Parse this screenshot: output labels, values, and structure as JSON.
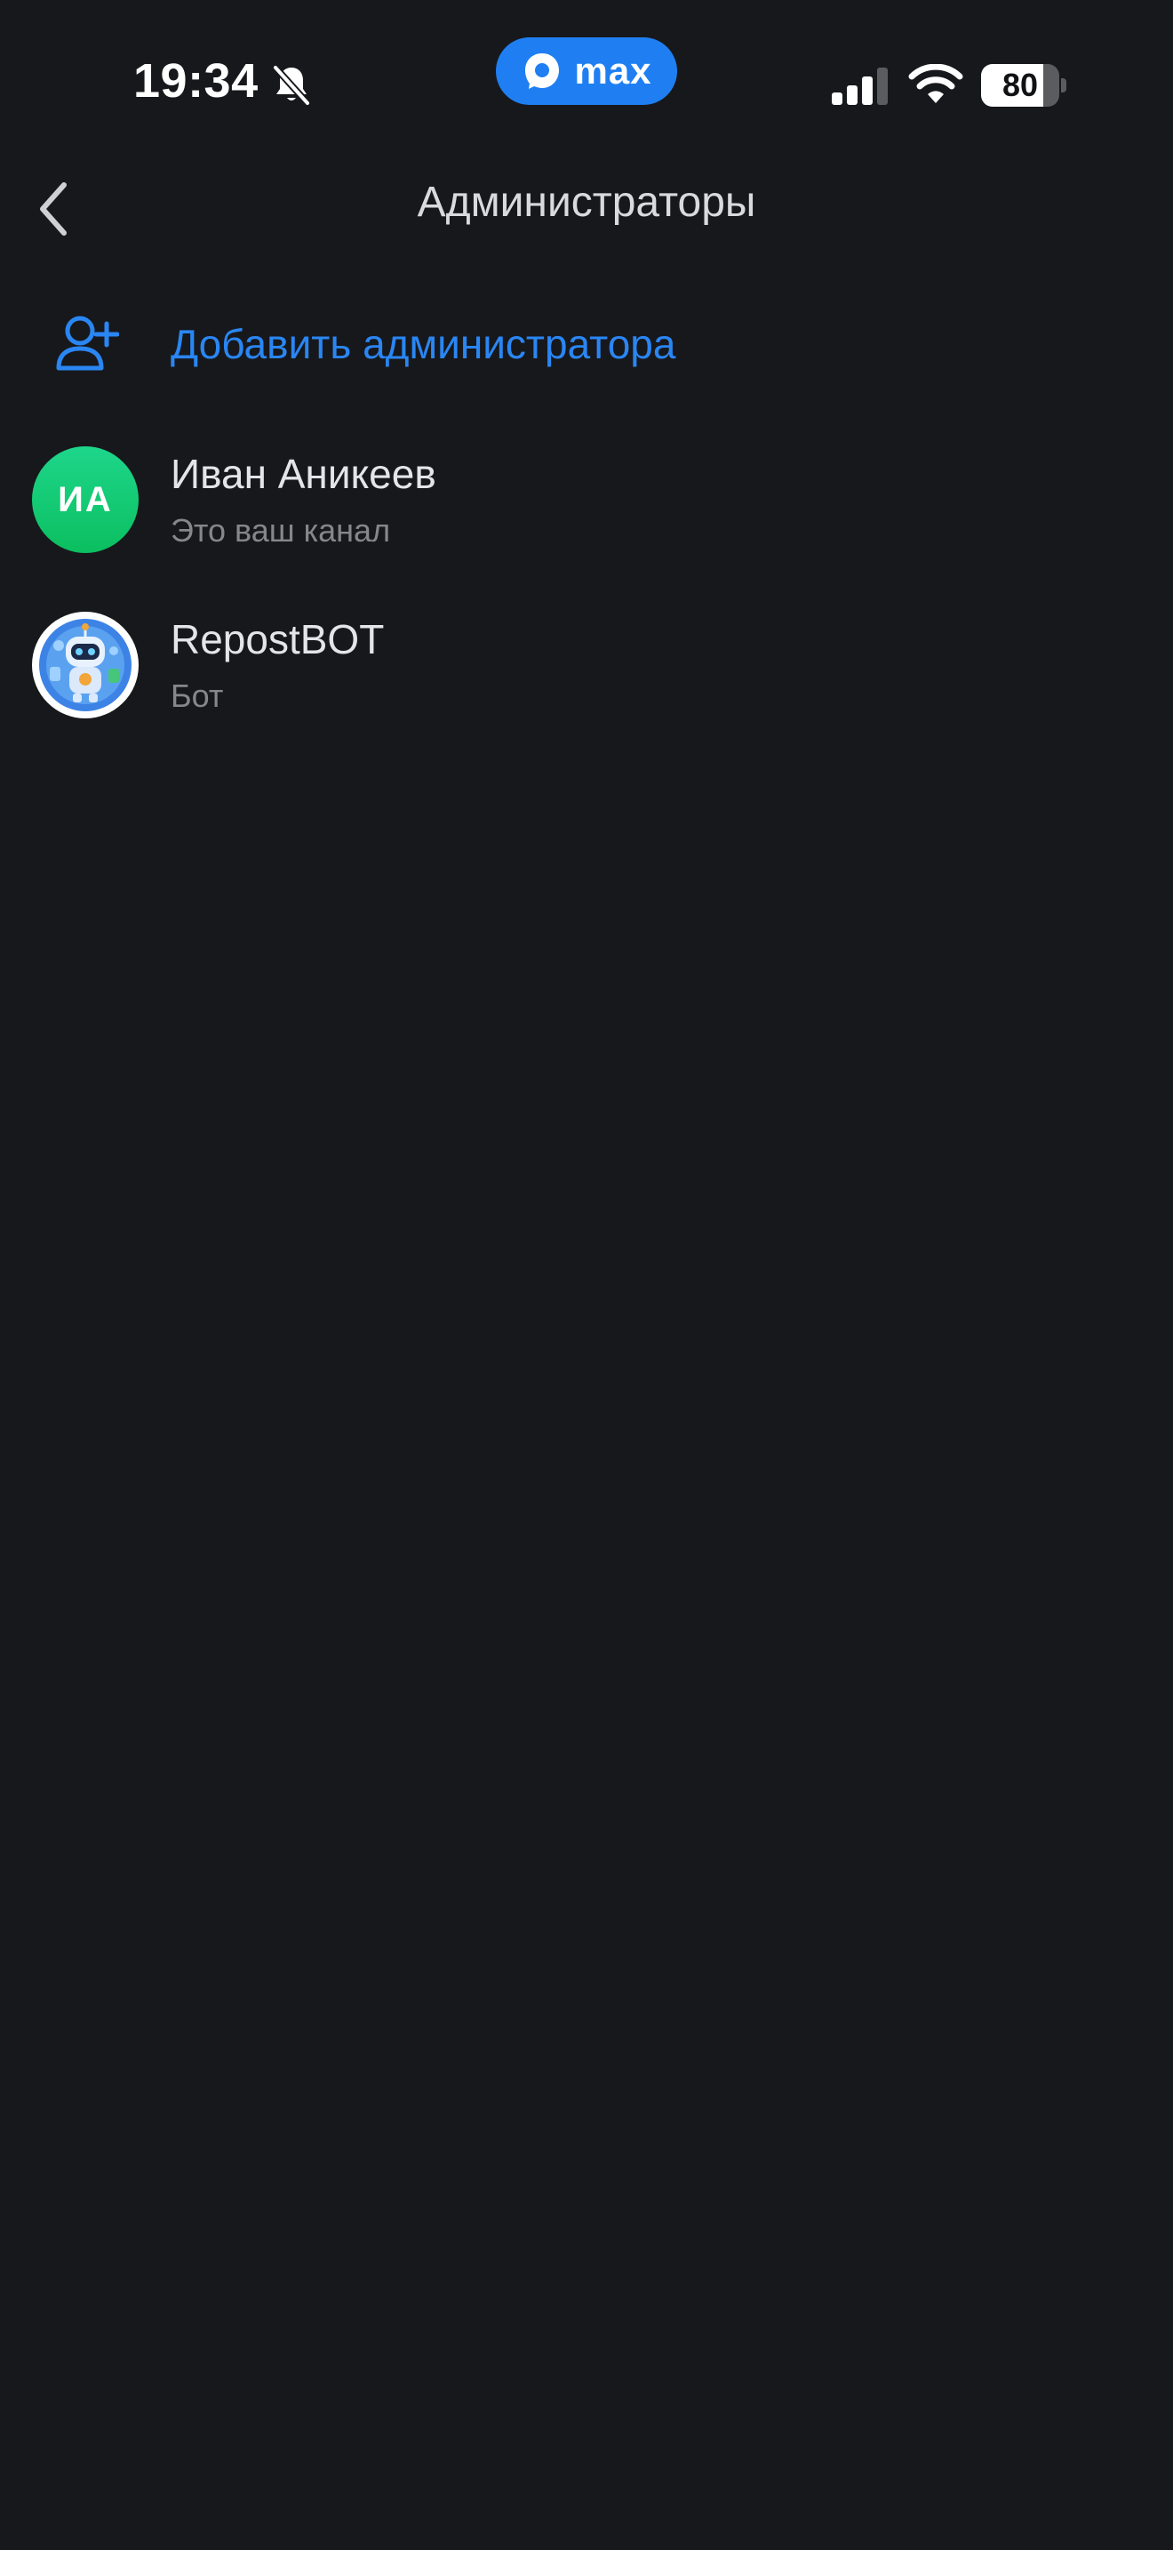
{
  "status_bar": {
    "time": "19:34",
    "app_badge_label": "max",
    "battery_level": "80",
    "battery_fraction": 0.8,
    "icons": [
      "bell-slash-icon",
      "max-logo-icon",
      "cellular-signal-icon",
      "wifi-icon",
      "battery-icon"
    ]
  },
  "header": {
    "title": "Администраторы",
    "back_icon": "chevron-left-icon"
  },
  "add_admin": {
    "label": "Добавить администратора",
    "icon": "user-plus-icon",
    "color": "#2a86f3"
  },
  "admins": [
    {
      "initials": "ИА",
      "name": "Иван Аникеев",
      "role": "Это ваш канал",
      "avatar_color": "#12cc72"
    },
    {
      "name": "RepostBOT",
      "role": "Бот",
      "avatar_icon": "robot-avatar-icon"
    }
  ],
  "colors": {
    "background": "#17181c",
    "accent": "#1f7ff2"
  }
}
